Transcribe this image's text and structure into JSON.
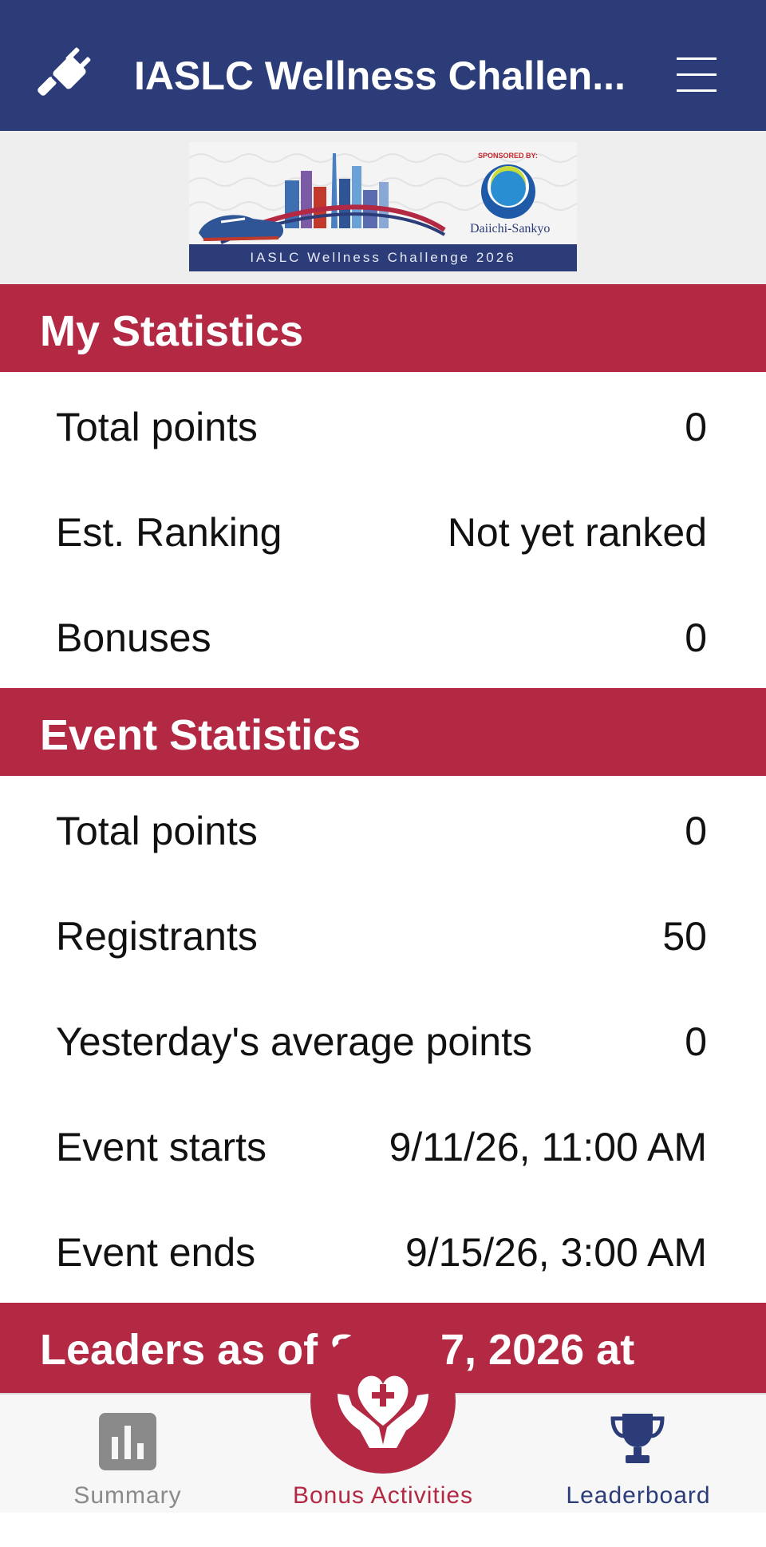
{
  "header": {
    "title": "IASLC Wellness Challen...",
    "icons": {
      "logo": "plug-icon",
      "menu": "hamburger-menu-icon"
    }
  },
  "banner": {
    "sponsor_label": "SPONSORED BY:",
    "sponsor_name": "Daiichi-Sankyo",
    "caption": "IASLC Wellness Challenge 2026"
  },
  "my_statistics": {
    "title": "My Statistics",
    "rows": [
      {
        "label": "Total points",
        "value": "0"
      },
      {
        "label": "Est. Ranking",
        "value": "Not yet ranked"
      },
      {
        "label": "Bonuses",
        "value": "0"
      }
    ]
  },
  "event_statistics": {
    "title": "Event Statistics",
    "rows": [
      {
        "label": "Total points",
        "value": "0"
      },
      {
        "label": "Registrants",
        "value": "50"
      },
      {
        "label": "Yesterday's average points",
        "value": "0"
      },
      {
        "label": "Event starts",
        "value": "9/11/26, 11:00 AM"
      },
      {
        "label": "Event ends",
        "value": "9/15/26, 3:00 AM"
      }
    ]
  },
  "leaders": {
    "title_visible_left": "Leaders as of S",
    "title_visible_right": "7, 2026 at"
  },
  "tabbar": {
    "tabs": [
      {
        "label": "Summary",
        "icon": "bar-chart-icon"
      },
      {
        "label": "Bonus Activities",
        "icon": "heart-hands-icon"
      },
      {
        "label": "Leaderboard",
        "icon": "trophy-icon"
      }
    ]
  },
  "colors": {
    "nav_blue": "#2b3c78",
    "section_red": "#b32843",
    "tab_inactive": "#8a8a8a"
  }
}
